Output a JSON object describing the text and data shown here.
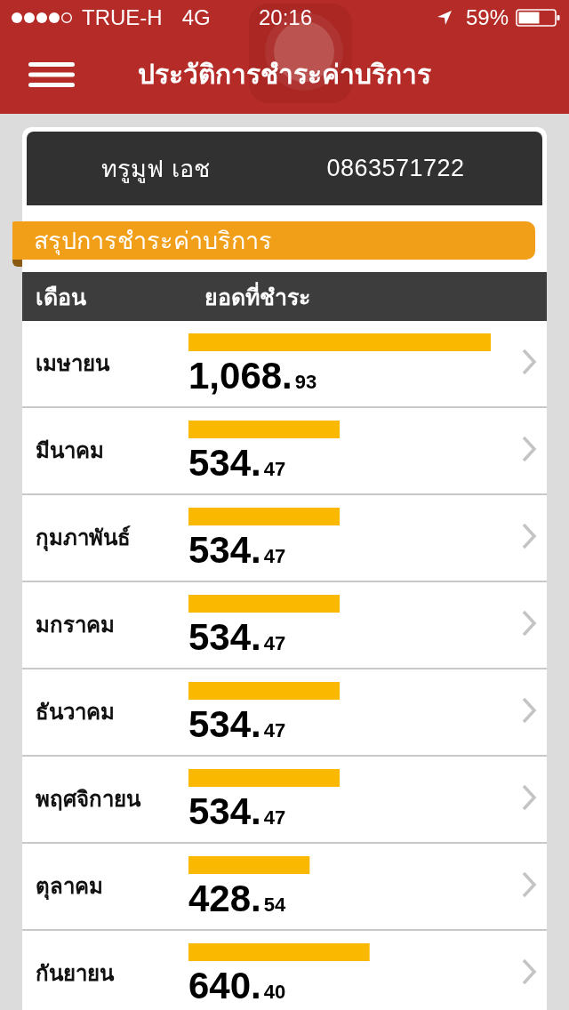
{
  "status_bar": {
    "carrier": "TRUE-H",
    "network": "4G",
    "time": "20:16",
    "battery": "59%"
  },
  "header": {
    "title": "ประวัติการชำระค่าบริการ"
  },
  "account": {
    "name": "ทรูมูฟ เอช",
    "number": "0863571722"
  },
  "section_title": "สรุปการชำระค่าบริการ",
  "table": {
    "columns": [
      "เดือน",
      "ยอดที่ชำระ"
    ],
    "chart_data": {
      "type": "bar",
      "orientation": "horizontal",
      "categories": [
        "เมษายน",
        "มีนาคม",
        "กุมภาพันธ์",
        "มกราคม",
        "ธันวาคม",
        "พฤศจิกายน",
        "ตุลาคม",
        "กันยายน"
      ],
      "values": [
        1068.93,
        534.47,
        534.47,
        534.47,
        534.47,
        534.47,
        428.54,
        640.4
      ],
      "value_labels": [
        "1,068.93",
        "534.47",
        "534.47",
        "534.47",
        "534.47",
        "534.47",
        "428.54",
        "640.40"
      ]
    }
  }
}
